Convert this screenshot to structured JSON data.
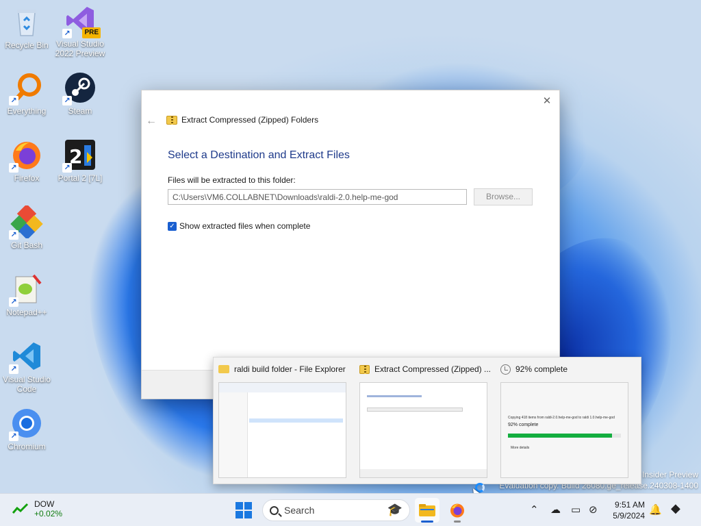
{
  "desktop": {
    "icons": [
      {
        "label": "Recycle Bin"
      },
      {
        "label": "Visual Studio 2022 Preview",
        "badge": "PRE"
      },
      {
        "label": "Everything"
      },
      {
        "label": "Steam"
      },
      {
        "label": "Firefox"
      },
      {
        "label": "Portal 2 [7L]"
      },
      {
        "label": "Git Bash"
      },
      {
        "label": "Notepad++"
      },
      {
        "label": "Visual Studio Code"
      },
      {
        "label": "Chromium"
      }
    ]
  },
  "dialog": {
    "title": "Extract Compressed (Zipped) Folders",
    "heading": "Select a Destination and Extract Files",
    "field_label": "Files will be extracted to this folder:",
    "path_value": "C:\\Users\\VM6.COLLABNET\\Downloads\\raldi-2.0.help-me-god",
    "browse_label": "Browse...",
    "show_files_label": "Show extracted files when complete",
    "show_files_checked": true
  },
  "watermark": {
    "line1": "Insider Preview",
    "line2": "Evaluation copy. Build 26080.ge_release.240308-1400"
  },
  "previews": [
    {
      "title": "raldi build folder - File Explorer"
    },
    {
      "title": "Extract Compressed (Zipped) ..."
    },
    {
      "title": "92% complete",
      "progress_text": "92% complete",
      "copy_text": "Copying 418 items from raldi-2.0.help-me-god to raldi 1.0.help-me-god",
      "more_details": "More details",
      "progress": 0.92
    }
  ],
  "taskbar": {
    "ticker_name": "DOW",
    "ticker_change": "+0.02%",
    "search_placeholder": "Search",
    "time": "9:51 AM",
    "date": "5/9/2024"
  },
  "colors": {
    "accent": "#1a5fd0",
    "ticker_up": "#107c10",
    "progress": "#14ae3f"
  }
}
